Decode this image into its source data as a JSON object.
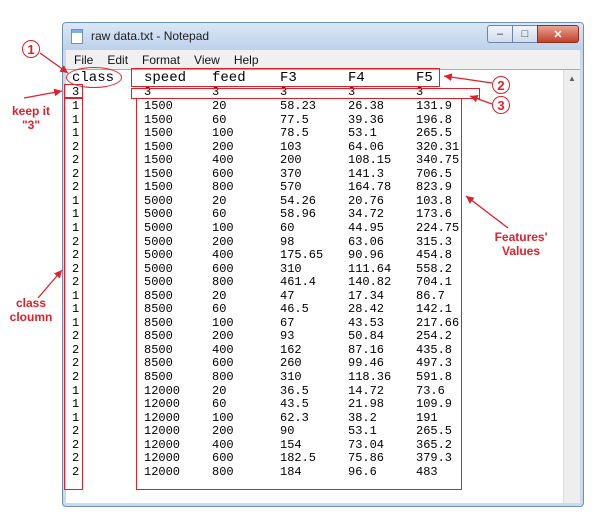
{
  "window": {
    "title": "raw data.txt - Notepad",
    "buttons": {
      "minimize": "–",
      "maximize": "□",
      "close": "✕"
    }
  },
  "menu": [
    "File",
    "Edit",
    "Format",
    "View",
    "Help"
  ],
  "document": {
    "header": [
      "class",
      "speed",
      "feed",
      "F3",
      "F4",
      "F5"
    ],
    "type_row": [
      "3",
      "3",
      "3",
      "3",
      "3",
      "3"
    ],
    "rows": [
      [
        "1",
        "1500",
        "20",
        "58.23",
        "26.38",
        "131.9"
      ],
      [
        "1",
        "1500",
        "60",
        "77.5",
        "39.36",
        "196.8"
      ],
      [
        "1",
        "1500",
        "100",
        "78.5",
        "53.1",
        "265.5"
      ],
      [
        "2",
        "1500",
        "200",
        "103",
        "64.06",
        "320.31"
      ],
      [
        "2",
        "1500",
        "400",
        "200",
        "108.15",
        "340.75"
      ],
      [
        "2",
        "1500",
        "600",
        "370",
        "141.3",
        "706.5"
      ],
      [
        "2",
        "1500",
        "800",
        "570",
        "164.78",
        "823.9"
      ],
      [
        "1",
        "5000",
        "20",
        "54.26",
        "20.76",
        "103.8"
      ],
      [
        "1",
        "5000",
        "60",
        "58.96",
        "34.72",
        "173.6"
      ],
      [
        "1",
        "5000",
        "100",
        "60",
        "44.95",
        "224.75"
      ],
      [
        "2",
        "5000",
        "200",
        "98",
        "63.06",
        "315.3"
      ],
      [
        "2",
        "5000",
        "400",
        "175.65",
        "90.96",
        "454.8"
      ],
      [
        "2",
        "5000",
        "600",
        "310",
        "111.64",
        "558.2"
      ],
      [
        "2",
        "5000",
        "800",
        "461.4",
        "140.82",
        "704.1"
      ],
      [
        "1",
        "8500",
        "20",
        "47",
        "17.34",
        "86.7"
      ],
      [
        "1",
        "8500",
        "60",
        "46.5",
        "28.42",
        "142.1"
      ],
      [
        "1",
        "8500",
        "100",
        "67",
        "43.53",
        "217.66"
      ],
      [
        "2",
        "8500",
        "200",
        "93",
        "50.84",
        "254.2"
      ],
      [
        "2",
        "8500",
        "400",
        "162",
        "87.16",
        "435.8"
      ],
      [
        "2",
        "8500",
        "600",
        "260",
        "99.46",
        "497.3"
      ],
      [
        "2",
        "8500",
        "800",
        "310",
        "118.36",
        "591.8"
      ],
      [
        "1",
        "12000",
        "20",
        "36.5",
        "14.72",
        "73.6"
      ],
      [
        "1",
        "12000",
        "60",
        "43.5",
        "21.98",
        "109.9"
      ],
      [
        "1",
        "12000",
        "100",
        "62.3",
        "38.2",
        "191"
      ],
      [
        "2",
        "12000",
        "200",
        "90",
        "53.1",
        "265.5"
      ],
      [
        "2",
        "12000",
        "400",
        "154",
        "73.04",
        "365.2"
      ],
      [
        "2",
        "12000",
        "600",
        "182.5",
        "75.86",
        "379.3"
      ],
      [
        "2",
        "12000",
        "800",
        "184",
        "96.6",
        "483"
      ]
    ]
  },
  "annotations": {
    "badge1": "1",
    "badge2": "2",
    "badge3": "3",
    "keep_note": "keep it \"3\"",
    "class_column_note": "class cloumn",
    "features_note": "Features' Values",
    "color": "#e0202a"
  },
  "scrollbar": {
    "up_arrow": "▲"
  }
}
